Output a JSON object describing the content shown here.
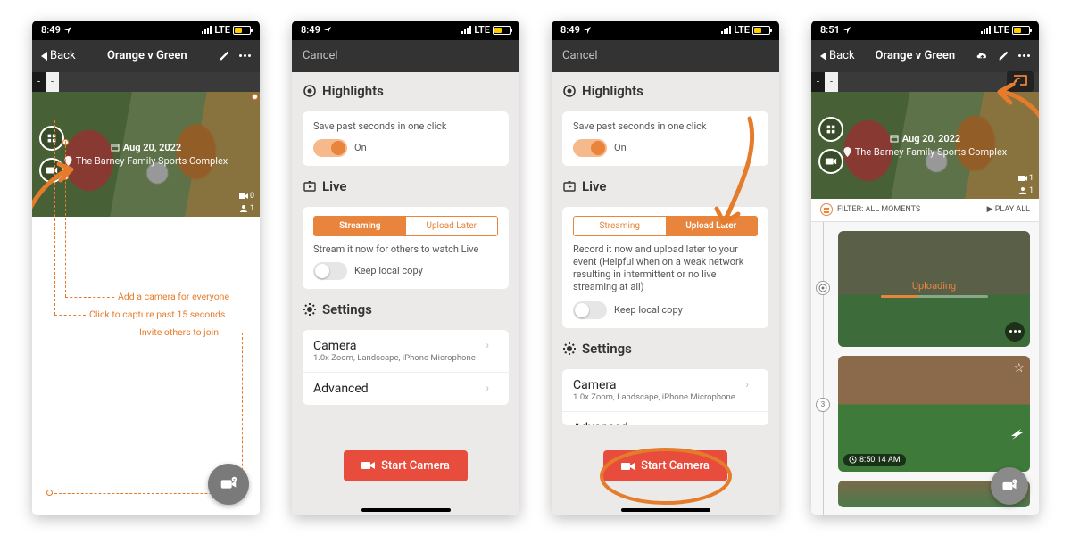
{
  "status": {
    "time1": "8:49",
    "time4": "8:51",
    "carrier": "LTE"
  },
  "screen1": {
    "back_label": "Back",
    "title": "Orange v Green",
    "date": "Aug 20, 2022",
    "location": "The Barney Family Sports Complex",
    "score_home": "-",
    "score_away": "-",
    "cam_count": "0",
    "people_count": "1",
    "annot_camera": "Add a camera for everyone",
    "annot_capture": "Click to capture past 15 seconds",
    "annot_invite": "Invite others to join"
  },
  "settings": {
    "cancel": "Cancel",
    "highlights_title": "Highlights",
    "highlights_desc": "Save past seconds in one click",
    "toggle_on": "On",
    "live_title": "Live",
    "streaming_tab": "Streaming",
    "upload_later_tab": "Upload Later",
    "streaming_desc": "Stream it now for others to watch Live",
    "upload_later_desc": "Record it now and upload later to your event (Helpful when on a weak network resulting in intermittent or no live streaming at all)",
    "keep_local": "Keep local copy",
    "settings_title": "Settings",
    "camera_label": "Camera",
    "camera_sub": "1.0x Zoom, Landscape, iPhone Microphone",
    "advanced_label": "Advanced",
    "start_camera": "Start Camera"
  },
  "screen4": {
    "back_label": "Back",
    "title": "Orange v Green",
    "filter_label": "FILTER: ALL MOMENTS",
    "play_all": "▶ PLAY ALL",
    "uploading": "Uploading",
    "timestamp": "8:50:14 AM",
    "timeline_count": "3",
    "cam_count": "1",
    "people_count": "1"
  }
}
